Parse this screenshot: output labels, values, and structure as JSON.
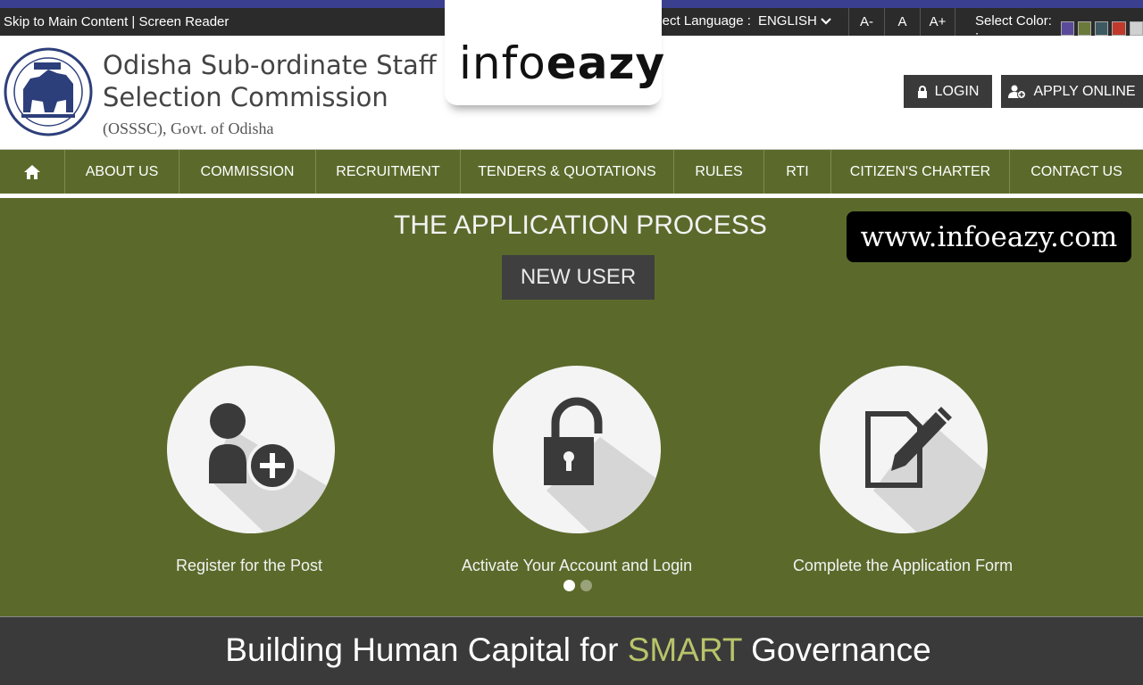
{
  "topbar": {
    "skip_main": "Skip to Main Content",
    "separator": "|",
    "screen_reader": "Screen Reader",
    "language_label": "elect Language :",
    "language_value": "ENGLISH",
    "font_decrease": "A-",
    "font_normal": "A",
    "font_increase": "A+",
    "color_label": "Select Color: :",
    "color_swatches": [
      "#5b4a9a",
      "#6b7a3a",
      "#3d5a63",
      "#c0392b",
      "#d0d0d0"
    ]
  },
  "header": {
    "title_line1": "Odisha Sub-ordinate Staff",
    "title_line2": "Selection Commission",
    "title_line3": "(OSSSC), Govt. of Odisha",
    "brand_logo_plain": "info",
    "brand_logo_bold": "eazy",
    "login_label": "LOGIN",
    "apply_label": "APPLY ONLINE"
  },
  "nav": {
    "items": [
      "ABOUT US",
      "COMMISSION",
      "RECRUITMENT",
      "TENDERS & QUOTATIONS",
      "RULES",
      "RTI",
      "CITIZEN'S CHARTER",
      "CONTACT US"
    ]
  },
  "main": {
    "heading": "THE APPLICATION PROCESS",
    "tab_label": "NEW USER",
    "watermark": "www.infoeazy.com",
    "steps": [
      {
        "label": "Register for the Post",
        "icon": "add-user-icon"
      },
      {
        "label": "Activate Your Account and Login",
        "icon": "unlock-icon"
      },
      {
        "label": "Complete the Application Form",
        "icon": "edit-form-icon"
      }
    ],
    "carousel_active": 1,
    "carousel_total": 2
  },
  "footer": {
    "slogan_pre": "Building Human Capital for ",
    "slogan_highlight": "SMART",
    "slogan_post": " Governance"
  },
  "colors": {
    "nav_bg": "#5b6a2b",
    "dark_btn": "#3a3a3a",
    "accent_highlight": "#b9c46a"
  }
}
